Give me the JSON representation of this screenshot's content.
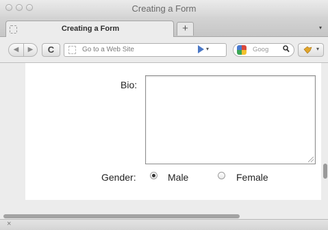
{
  "window": {
    "title": "Creating a Form"
  },
  "tabs": [
    {
      "label": "Creating a Form",
      "active": true
    }
  ],
  "tab_strip": {
    "new_tab_glyph": "+",
    "overflow_glyph": "▾"
  },
  "toolbar": {
    "back_glyph": "◀",
    "forward_glyph": "▶",
    "reload_glyph": "C",
    "url_placeholder": "Go to a Web Site",
    "go_dropdown_glyph": "▾",
    "search_placeholder": "Goog",
    "search_icon_glyph": "🔍",
    "extension_glyph": "▾"
  },
  "form": {
    "bio_label": "Bio:",
    "bio_value": "",
    "gender_label": "Gender:",
    "gender_options": [
      {
        "label": "Male",
        "checked": true
      },
      {
        "label": "Female",
        "checked": false
      }
    ]
  },
  "statusbar": {
    "close_glyph": "×"
  },
  "colors": {
    "go_arrow": "#4b78c6",
    "window_bg": "#ececec"
  }
}
